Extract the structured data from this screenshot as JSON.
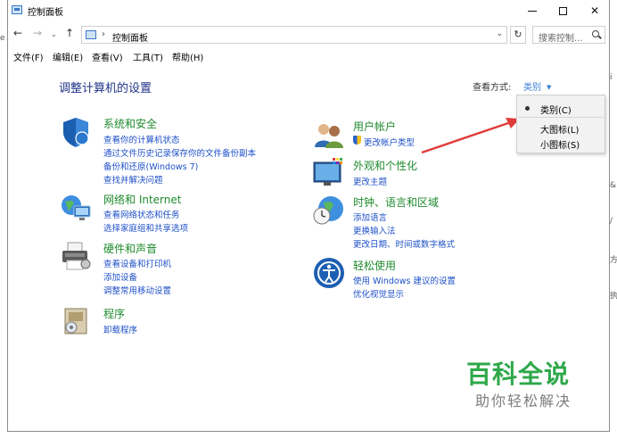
{
  "window": {
    "title": "控制面板"
  },
  "address": {
    "crumb": "控制面板",
    "search_placeholder": "搜索控制... "
  },
  "menu": [
    "文件(F)",
    "编辑(E)",
    "查看(V)",
    "工具(T)",
    "帮助(H)"
  ],
  "heading": "调整计算机的设置",
  "view_by": {
    "label": "查看方式:",
    "value": "类别"
  },
  "dropdown": {
    "options": [
      "类别(C)",
      "大图标(L)",
      "小图标(S)"
    ],
    "selected": "类别(C)"
  },
  "categories": {
    "system": {
      "title": "系统和安全",
      "links": [
        "查看你的计算机状态",
        "通过文件历史记录保存你的文件备份副本",
        "备份和还原(Windows 7)",
        "查找并解决问题"
      ]
    },
    "network": {
      "title": "网络和 Internet",
      "links": [
        "查看网络状态和任务",
        "选择家庭组和共享选项"
      ]
    },
    "hardware": {
      "title": "硬件和声音",
      "links": [
        "查看设备和打印机",
        "添加设备",
        "调整常用移动设置"
      ]
    },
    "programs": {
      "title": "程序",
      "links": [
        "卸载程序"
      ]
    },
    "accounts": {
      "title": "用户帐户",
      "links": [
        "更改帐户类型"
      ]
    },
    "appearance": {
      "title": "外观和个性化",
      "links": [
        "更改主题"
      ]
    },
    "clock": {
      "title": "时钟、语言和区域",
      "links": [
        "添加语言",
        "更换输入法",
        "更改日期、时间或数字格式"
      ]
    },
    "ease": {
      "title": "轻松使用",
      "links": [
        "使用 Windows 建议的设置",
        "优化视觉显示"
      ]
    }
  },
  "watermark": {
    "title": "百科全说",
    "subtitle": "助你轻松解决"
  },
  "edge": {
    "left": "e",
    "right": [
      "i",
      "&",
      "/",
      "方",
      "执"
    ]
  },
  "colors": {
    "accent_link": "#1e50c8",
    "category_title": "#1f8b2e",
    "heading": "#1e3287",
    "arrow": "#e03c3c",
    "watermark": "#2fa84a"
  }
}
